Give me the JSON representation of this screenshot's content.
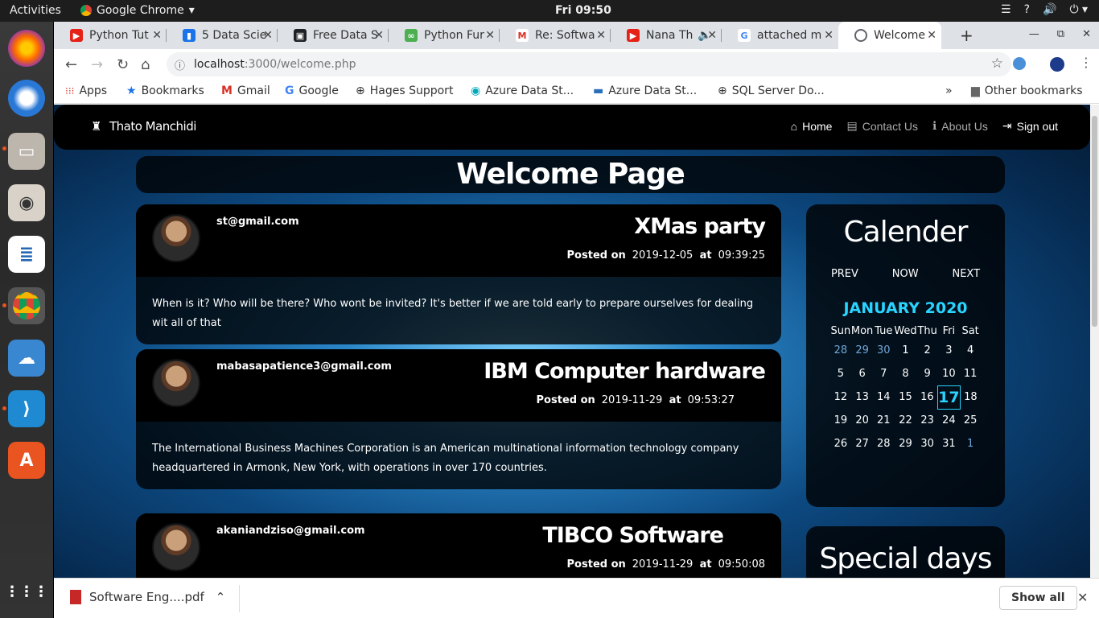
{
  "topbar": {
    "activities": "Activities",
    "app_name": "Google Chrome",
    "clock": "Fri 09:50"
  },
  "tabs": [
    {
      "label": "Python Tut",
      "color": "#e62117"
    },
    {
      "label": "5 Data Scie",
      "color": "#1a73e8"
    },
    {
      "label": "Free Data S",
      "color": "#202124"
    },
    {
      "label": "Python Fur",
      "color": "#4caf50"
    },
    {
      "label": "Re: Softwa",
      "color": "#d93025"
    },
    {
      "label": "Nana Th",
      "color": "#e62117"
    },
    {
      "label": "attached m",
      "color": "#4285f4"
    },
    {
      "label": "Welcome",
      "color": "#5f6368"
    }
  ],
  "address": {
    "host": "localhost",
    "path": ":3000/welcome.php"
  },
  "bookmarks": [
    "Apps",
    "Bookmarks",
    "Gmail",
    "Google",
    "Hages Support",
    "Azure Data St...",
    "Azure Data St...",
    "SQL Server Do..."
  ],
  "other_bookmarks": "Other bookmarks",
  "site": {
    "brand": "Thato Manchidi",
    "nav": {
      "home": "Home",
      "contact": "Contact Us",
      "about": "About Us",
      "signout": "Sign out"
    },
    "title": "Welcome Page",
    "posted_label": "Posted on",
    "at_label": "at",
    "posts": [
      {
        "email": "st@gmail.com",
        "title": "XMas party",
        "date": "2019-12-05",
        "time": "09:39:25",
        "body": "When is it? Who will be there? Who wont be invited? It's better if we are told early to prepare ourselves for dealing wit all of that"
      },
      {
        "email": "mabasapatience3@gmail.com",
        "title": "IBM Computer hardware",
        "date": "2019-11-29",
        "time": "09:53:27",
        "body": "The International Business Machines Corporation is an American multinational information technology company headquartered in Armonk, New York, with operations in over 170 countries."
      },
      {
        "email": "akaniandziso@gmail.com",
        "title": "TIBCO Software",
        "date": "2019-11-29",
        "time": "09:50:08",
        "body": ""
      }
    ],
    "calendar": {
      "title": "Calender",
      "prev": "PREV",
      "now": "NOW",
      "next": "NEXT",
      "month": "JANUARY 2020",
      "weekdays": [
        "Sun",
        "Mon",
        "Tue",
        "Wed",
        "Thu",
        "Fri",
        "Sat"
      ],
      "weeks": [
        [
          "28",
          "29",
          "30",
          "1",
          "2",
          "3",
          "4"
        ],
        [
          "5",
          "6",
          "7",
          "8",
          "9",
          "10",
          "11"
        ],
        [
          "12",
          "13",
          "14",
          "15",
          "16",
          "17",
          "18"
        ],
        [
          "19",
          "20",
          "21",
          "22",
          "23",
          "24",
          "25"
        ],
        [
          "26",
          "27",
          "28",
          "29",
          "30",
          "31",
          "1"
        ]
      ],
      "today": "17"
    },
    "special_title": "Special days"
  },
  "downloads": {
    "file": "Software Eng....pdf",
    "show_all": "Show all"
  }
}
